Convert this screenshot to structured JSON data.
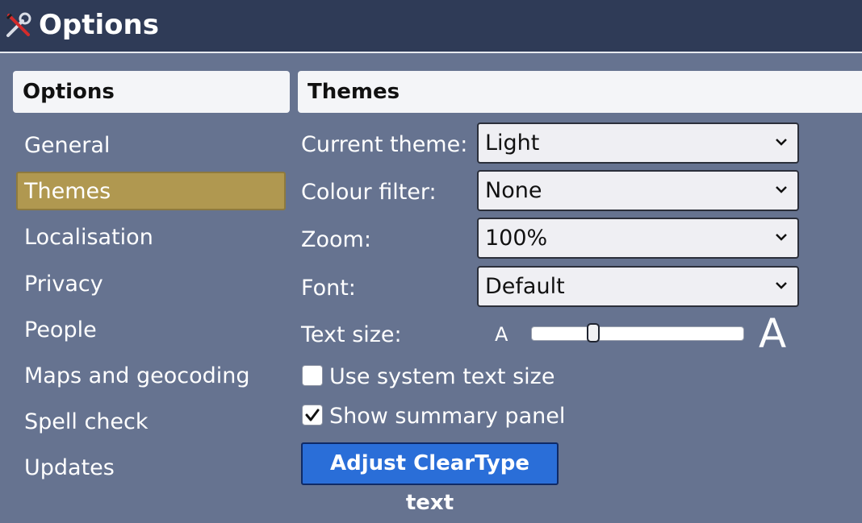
{
  "window": {
    "title": "Options",
    "icon": "tools-icon"
  },
  "sidebar": {
    "header": "Options",
    "items": [
      {
        "label": "General",
        "selected": false
      },
      {
        "label": "Themes",
        "selected": true
      },
      {
        "label": "Localisation",
        "selected": false
      },
      {
        "label": "Privacy",
        "selected": false
      },
      {
        "label": "People",
        "selected": false
      },
      {
        "label": "Maps and geocoding",
        "selected": false
      },
      {
        "label": "Spell check",
        "selected": false
      },
      {
        "label": "Updates",
        "selected": false
      }
    ]
  },
  "themes": {
    "header": "Themes",
    "current_theme": {
      "label": "Current theme:",
      "value": "Light"
    },
    "colour_filter": {
      "label": "Colour filter:",
      "value": "None"
    },
    "zoom": {
      "label": "Zoom:",
      "value": "100%"
    },
    "font": {
      "label": "Font:",
      "value": "Default"
    },
    "text_size": {
      "label": "Text size:",
      "small_glyph": "A",
      "large_glyph": "A",
      "level": 0.28
    },
    "use_system_text_size": {
      "label": "Use system text size",
      "checked": false
    },
    "show_summary_panel": {
      "label": "Show summary panel",
      "checked": true
    },
    "adjust_cleartype_button": "Adjust ClearType text"
  },
  "colors": {
    "title_bar": "#2f3b57",
    "background": "#667390",
    "selected_item": "#b09850",
    "primary_button": "#2a6ed8"
  }
}
